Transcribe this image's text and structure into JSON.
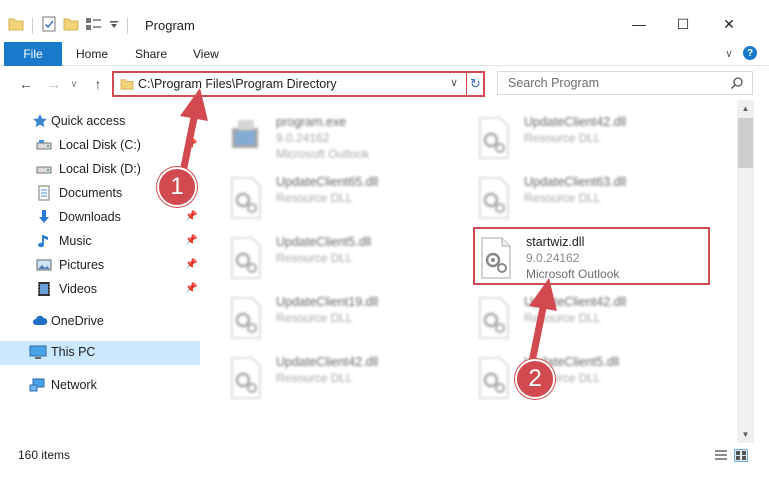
{
  "window": {
    "title": "Program",
    "minimize_glyph": "—",
    "maximize_glyph": "☐",
    "close_glyph": "✕"
  },
  "ribbon": {
    "file": "File",
    "home": "Home",
    "share": "Share",
    "view": "View",
    "expand_glyph": "∨",
    "help_glyph": "?"
  },
  "address": {
    "path": "C:\\Program Files\\Program Directory",
    "dropdown_glyph": "∨",
    "refresh_glyph": "↻"
  },
  "search": {
    "placeholder": "Search Program"
  },
  "nav": {
    "back_glyph": "←",
    "forward_glyph": "→",
    "recent_glyph": "∨",
    "up_glyph": "↑",
    "pin_glyph": "📌",
    "items": [
      {
        "label": "Quick access",
        "icon": "star-icon"
      },
      {
        "label": "Local Disk (C:)",
        "icon": "drive-icon"
      },
      {
        "label": "Local Disk (D:)",
        "icon": "drive-icon"
      },
      {
        "label": "Documents",
        "icon": "documents-icon"
      },
      {
        "label": "Downloads",
        "icon": "downloads-icon"
      },
      {
        "label": "Music",
        "icon": "music-icon"
      },
      {
        "label": "Pictures",
        "icon": "pictures-icon"
      },
      {
        "label": "Videos",
        "icon": "videos-icon"
      },
      {
        "label": "OneDrive",
        "icon": "cloud-icon"
      },
      {
        "label": "This PC",
        "icon": "computer-icon"
      },
      {
        "label": "Network",
        "icon": "network-icon"
      }
    ]
  },
  "files": [
    {
      "name": "program.exe",
      "version": "9.0.24162",
      "desc": "Microsoft Outlook"
    },
    {
      "name": "UpdateClient42.dll",
      "desc": "Resource DLL"
    },
    {
      "name": "UpdateClient65.dll",
      "desc": "Resource DLL"
    },
    {
      "name": "UpdateClient63.dll",
      "desc": "Resource DLL"
    },
    {
      "name": "UpdateClient5.dll",
      "desc": "Resource DLL"
    },
    {
      "name": "startwiz.dll",
      "version": "9.0.24162",
      "desc": "Microsoft Outlook"
    },
    {
      "name": "UpdateClient19.dll",
      "desc": "Resource DLL"
    },
    {
      "name": "UpdateClient42.dll",
      "desc": "Resource DLL"
    },
    {
      "name": "UpdateClient42.dll",
      "desc": "Resource DLL"
    },
    {
      "name": "UpdateClient5.dll",
      "desc": "Resource DLL"
    }
  ],
  "annotations": {
    "step1": "1",
    "step2": "2"
  },
  "status": {
    "items": "160 items"
  },
  "scroll": {
    "up_glyph": "▲",
    "down_glyph": "▼"
  },
  "colors": {
    "accent": "#1979ca",
    "annotation": "#d24a4f",
    "selected": "#cce8ff"
  }
}
